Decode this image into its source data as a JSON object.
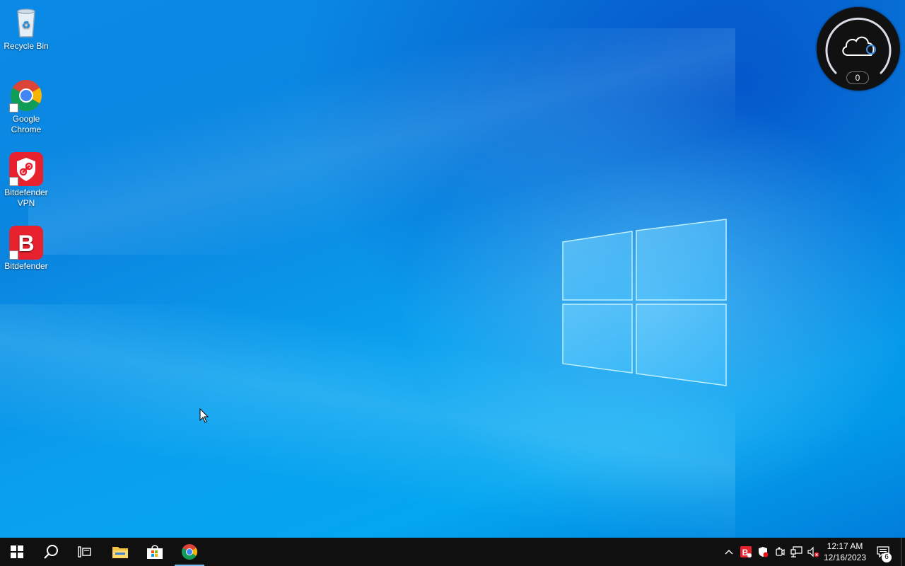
{
  "desktop": {
    "icons": [
      {
        "label": "Recycle Bin"
      },
      {
        "label": "Google Chrome"
      },
      {
        "label": "Bitdefender VPN"
      },
      {
        "label": "Bitdefender"
      }
    ]
  },
  "widget": {
    "icon": "cloud-sync-icon",
    "count": "0"
  },
  "taskbar": {
    "buttons": [
      "start-icon",
      "search-icon",
      "task-view-icon",
      "file-explorer-icon",
      "microsoft-store-icon",
      "chrome-icon"
    ],
    "tray_icons": [
      "chevron-up-icon",
      "bitdefender-tray-icon",
      "security-shield-icon",
      "meet-now-icon",
      "network-icon",
      "volume-muted-icon"
    ],
    "clock": {
      "time": "12:17 AM",
      "date": "12/16/2023"
    },
    "notifications_count": "6"
  },
  "colors": {
    "taskbar": "#101010",
    "accent": "#76b9ed",
    "bitdefender_red": "#e8212e"
  }
}
